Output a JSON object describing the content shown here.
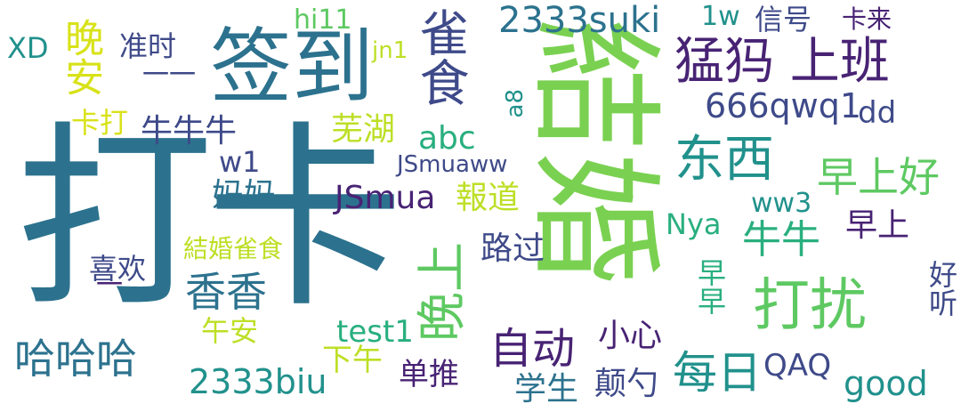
{
  "word_cloud": {
    "palette": {
      "dark_purple": "#482374",
      "indigo": "#3e4a89",
      "slate_blue": "#31688e",
      "teal_blue": "#2c728e",
      "teal": "#21918c",
      "sea_green": "#29af7f",
      "green": "#5ec962",
      "lime": "#7ad151",
      "yellow_green": "#bddf26",
      "yellow": "#d8e219"
    },
    "words": [
      {
        "text": "打卡",
        "color": "#2c728e"
      },
      {
        "text": "結婚",
        "color": "#7ad151"
      },
      {
        "text": "签到",
        "color": "#2c728e"
      },
      {
        "text": "猛犸 上班",
        "color": "#482374"
      },
      {
        "text": "雀食",
        "color": "#3e4a89"
      },
      {
        "text": "晚安",
        "color": "#d8e219"
      },
      {
        "text": "晚上",
        "color": "#5ec962"
      },
      {
        "text": "打扰",
        "color": "#5ec962"
      },
      {
        "text": "东西",
        "color": "#21918c"
      },
      {
        "text": "早上好",
        "color": "#5ec962"
      },
      {
        "text": "香香",
        "color": "#2c728e"
      },
      {
        "text": "哈哈哈",
        "color": "#2c728e"
      },
      {
        "text": "自动",
        "color": "#482374"
      },
      {
        "text": "每日",
        "color": "#21918c"
      },
      {
        "text": "牛牛",
        "color": "#29af7f"
      },
      {
        "text": "2333suki",
        "color": "#2c728e"
      },
      {
        "text": "666qwq1",
        "color": "#3e4a89"
      },
      {
        "text": "JSmua",
        "color": "#482374"
      },
      {
        "text": "2333biu",
        "color": "#21918c"
      },
      {
        "text": "good",
        "color": "#21918c"
      },
      {
        "text": "QAQ",
        "color": "#3e4a89"
      },
      {
        "text": "test1",
        "color": "#29af7f"
      },
      {
        "text": "JSmuaww",
        "color": "#3e4a89"
      },
      {
        "text": "abc",
        "color": "#29af7f"
      },
      {
        "text": "hi11",
        "color": "#5ec962"
      },
      {
        "text": "1w",
        "color": "#21918c"
      },
      {
        "text": "信号",
        "color": "#3e4a89"
      },
      {
        "text": "卡来",
        "color": "#482374"
      },
      {
        "text": "XD",
        "color": "#21918c"
      },
      {
        "text": "jn1",
        "color": "#bddf26"
      },
      {
        "text": "准时",
        "color": "#3e4a89"
      },
      {
        "text": "一一",
        "color": "#3e4a89"
      },
      {
        "text": "卡打",
        "color": "#d8e219"
      },
      {
        "text": "牛牛牛",
        "color": "#3e4a89"
      },
      {
        "text": "芜湖",
        "color": "#bddf26"
      },
      {
        "text": "a8",
        "color": "#21918c"
      },
      {
        "text": "dd",
        "color": "#3e4a89"
      },
      {
        "text": "w1",
        "color": "#3e4a89"
      },
      {
        "text": "妈妈",
        "color": "#2c728e"
      },
      {
        "text": "報道",
        "color": "#bddf26"
      },
      {
        "text": "ww3",
        "color": "#21918c"
      },
      {
        "text": "Nya",
        "color": "#29af7f"
      },
      {
        "text": "早上",
        "color": "#482374"
      },
      {
        "text": "結婚雀食",
        "color": "#bddf26"
      },
      {
        "text": "喜欢",
        "color": "#3e4a89"
      },
      {
        "text": "路过",
        "color": "#3e4a89"
      },
      {
        "text": "早早",
        "color": "#29af7f"
      },
      {
        "text": "好听",
        "color": "#3e4a89"
      },
      {
        "text": "小心",
        "color": "#482374"
      },
      {
        "text": "午安",
        "color": "#bddf26"
      },
      {
        "text": "下午",
        "color": "#bddf26"
      },
      {
        "text": "单推",
        "color": "#482374"
      },
      {
        "text": "学生",
        "color": "#2c728e"
      },
      {
        "text": "颠勺",
        "color": "#3e4a89"
      },
      {
        "text": "一",
        "color": "#482374"
      }
    ]
  }
}
